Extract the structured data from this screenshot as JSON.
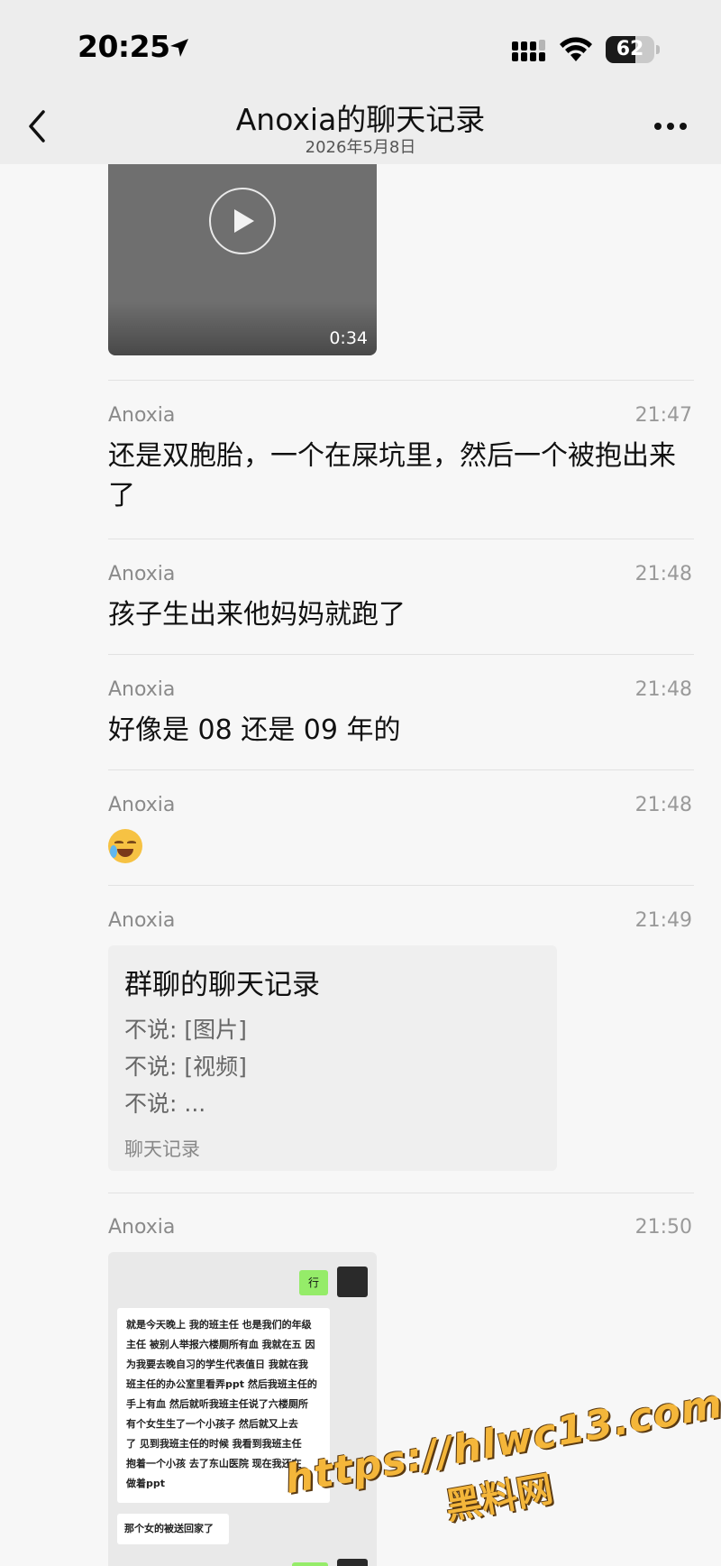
{
  "status_bar": {
    "time": "20:25",
    "battery": "62",
    "battery_level": 0.62
  },
  "nav": {
    "title": "Anoxia的聊天记录",
    "subtitle": "2026年5月8日"
  },
  "video": {
    "duration": "0:34"
  },
  "messages": [
    {
      "sender": "Anoxia",
      "time": "21:47",
      "text": "还是双胞胎，一个在屎坑里，然后一个被抱出来了"
    },
    {
      "sender": "Anoxia",
      "time": "21:48",
      "text": "孩子生出来他妈妈就跑了"
    },
    {
      "sender": "Anoxia",
      "time": "21:48",
      "text": "好像是 08 还是 09 年的"
    },
    {
      "sender": "Anoxia",
      "time": "21:48",
      "emoji": "crying-laughing-emoji"
    },
    {
      "sender": "Anoxia",
      "time": "21:49"
    },
    {
      "sender": "Anoxia",
      "time": "21:50"
    }
  ],
  "chat_record_card": {
    "title": "群聊的聊天记录",
    "lines": [
      "不说: [图片]",
      "不说: [视频]",
      "不说: ..."
    ],
    "footer": "聊天记录"
  },
  "screenshot_image": {
    "reply_1": "行",
    "story": "就是今天晚上 我的班主任 也是我们的年级主任 被别人举报六楼厕所有血 我就在五 因为我要去晚自习的学生代表值日 我就在我班主任的办公室里看弄ppt 然后我班主任的手上有血 然后就听我班主任说了六楼厕所有个女生生了一个小孩子 然后就又上去了 见到我班主任的时候 我看到我班主任抱着一个小孩 去了东山医院 现在我还在做着ppt",
    "story_lines": [
      "就是今天晚上 我的班主任 也是我们的年级",
      "主任 被别人举报六楼厕所有血 我就在五 因",
      "为我要去晚自习的学生代表值日 我就在我",
      "班主任的办公室里看弄ppt 然后我班主任的",
      "手上有血 然后就听我班主任说了六楼厕所",
      "有个女生生了一个小孩子 然后就又上去",
      "了 见到我班主任的时候 我看到我班主任",
      "抱着一个小孩 去了东山医院 现在我还在",
      "做着ppt"
    ],
    "reply_2": "那个女的被送回家了"
  },
  "watermark": {
    "url": "https://hlwc13.com",
    "name": "黑料网"
  }
}
